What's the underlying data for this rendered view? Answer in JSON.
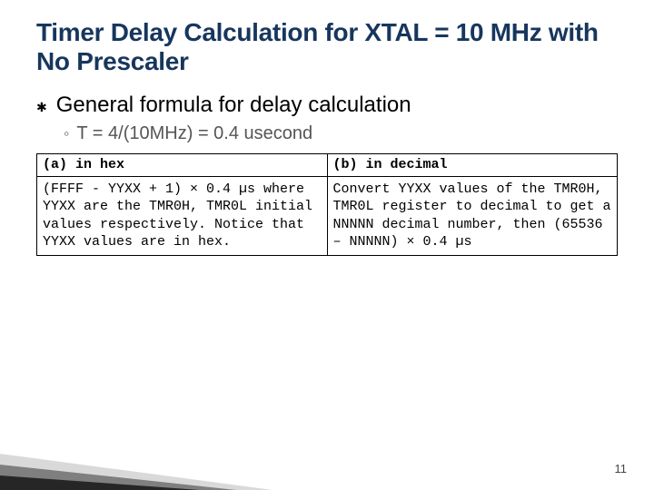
{
  "title": "Timer Delay Calculation for XTAL = 10 MHz with No Prescaler",
  "bullet": {
    "glyph": "✱",
    "text": "General formula for delay calculation"
  },
  "subbullet": {
    "glyph": "◦",
    "text": "T = 4/(10MHz) = 0.4 usecond"
  },
  "table": {
    "colA_header": "(a) in hex",
    "colB_header": "(b) in decimal",
    "colA_body": "(FFFF - YYXX + 1) × 0.4 µs where YYXX are the TMR0H, TMR0L initial values respectively. Notice that YYXX values are in hex.",
    "colB_body": "Convert YYXX values of the TMR0H, TMR0L register to decimal to get a NNNNN decimal number, then (65536 – NNNNN) × 0.4 µs"
  },
  "page_number": "11"
}
